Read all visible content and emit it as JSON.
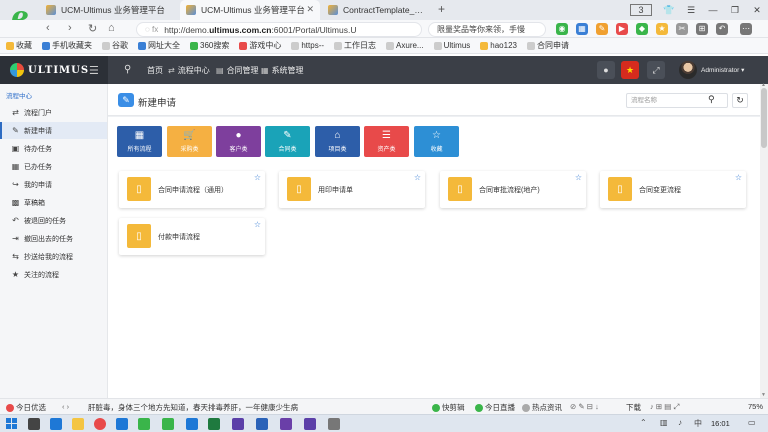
{
  "browser": {
    "tabs": [
      {
        "title": "UCM-Ultimus 业务管理平台"
      },
      {
        "title": "UCM-Ultimus 业务管理平台"
      },
      {
        "title": "ContractTemplate_Add"
      }
    ],
    "tab_count": "3",
    "url_prefix": "http://demo.",
    "url_domain": "ultimus.com.cn",
    "url_suffix": ":6001/Portal/Ultimus.U",
    "search_text": "限量奖品等你来领，手慢",
    "bookmarks": [
      "收藏",
      "手机收藏夹",
      "谷歌",
      "网址大全",
      "360搜索",
      "游戏中心",
      "https--",
      "工作日志",
      "Axure...",
      "Ultimus",
      "hao123",
      "合同申请"
    ]
  },
  "app": {
    "logo_text": "ULTIMUS",
    "nav": [
      {
        "label": "首页",
        "icon": "home-icon"
      },
      {
        "label": "流程中心",
        "icon": "shuffle-icon"
      },
      {
        "label": "合同管理",
        "icon": "contract-icon"
      },
      {
        "label": "系统管理",
        "icon": "grid-icon"
      }
    ],
    "user": "Administrator ▾"
  },
  "sidebar": {
    "title": "流程中心",
    "items": [
      {
        "label": "流程门户",
        "icon": "shuffle-icon",
        "active": false
      },
      {
        "label": "新建申请",
        "icon": "edit-icon",
        "active": true
      },
      {
        "label": "待办任务",
        "icon": "todo-icon",
        "active": false
      },
      {
        "label": "已办任务",
        "icon": "done-icon",
        "active": false
      },
      {
        "label": "我的申请",
        "icon": "share-icon",
        "active": false
      },
      {
        "label": "草稿箱",
        "icon": "draft-icon",
        "active": false
      },
      {
        "label": "被退回的任务",
        "icon": "undo-icon",
        "active": false
      },
      {
        "label": "撤回出去的任务",
        "icon": "redo-icon",
        "active": false
      },
      {
        "label": "抄送给我的流程",
        "icon": "cc-icon",
        "active": false
      },
      {
        "label": "关注的流程",
        "icon": "star-icon",
        "active": false
      }
    ]
  },
  "main": {
    "title": "新建申请",
    "search_placeholder": "流程名称",
    "categories": [
      {
        "label": "所有流程",
        "color": "#2d5ea9",
        "icon": "grid-icon"
      },
      {
        "label": "采购类",
        "color": "#f5b042",
        "icon": "cart-icon"
      },
      {
        "label": "客户类",
        "color": "#7e3f9d",
        "icon": "user-icon"
      },
      {
        "label": "合同类",
        "color": "#1aa3b8",
        "icon": "pencil-icon"
      },
      {
        "label": "项目类",
        "color": "#2d5ea9",
        "icon": "home-icon"
      },
      {
        "label": "资产类",
        "color": "#e84a4a",
        "icon": "list-icon"
      },
      {
        "label": "收藏",
        "color": "#2d8fd5",
        "icon": "star-icon"
      }
    ],
    "cards": [
      {
        "title": "合同申请流程（通用）"
      },
      {
        "title": "用印申请单"
      },
      {
        "title": "合同审批流程(地产)"
      },
      {
        "title": "合同变更流程"
      },
      {
        "title": "付款申请流程"
      }
    ]
  },
  "statusbar": {
    "left_label": "今日优选",
    "news": "肝脏毒，身体三个地方先知道，春天排毒养肝，一年健康少生病",
    "items": [
      "快剪辑",
      "今日直播",
      "热点资讯",
      "下载",
      "75%"
    ]
  },
  "taskbar": {
    "time": "16:01"
  },
  "colors": {
    "header_bg": "#3b3f47",
    "accent": "#2d6bc2",
    "doc_icon": "#f4b93a"
  }
}
